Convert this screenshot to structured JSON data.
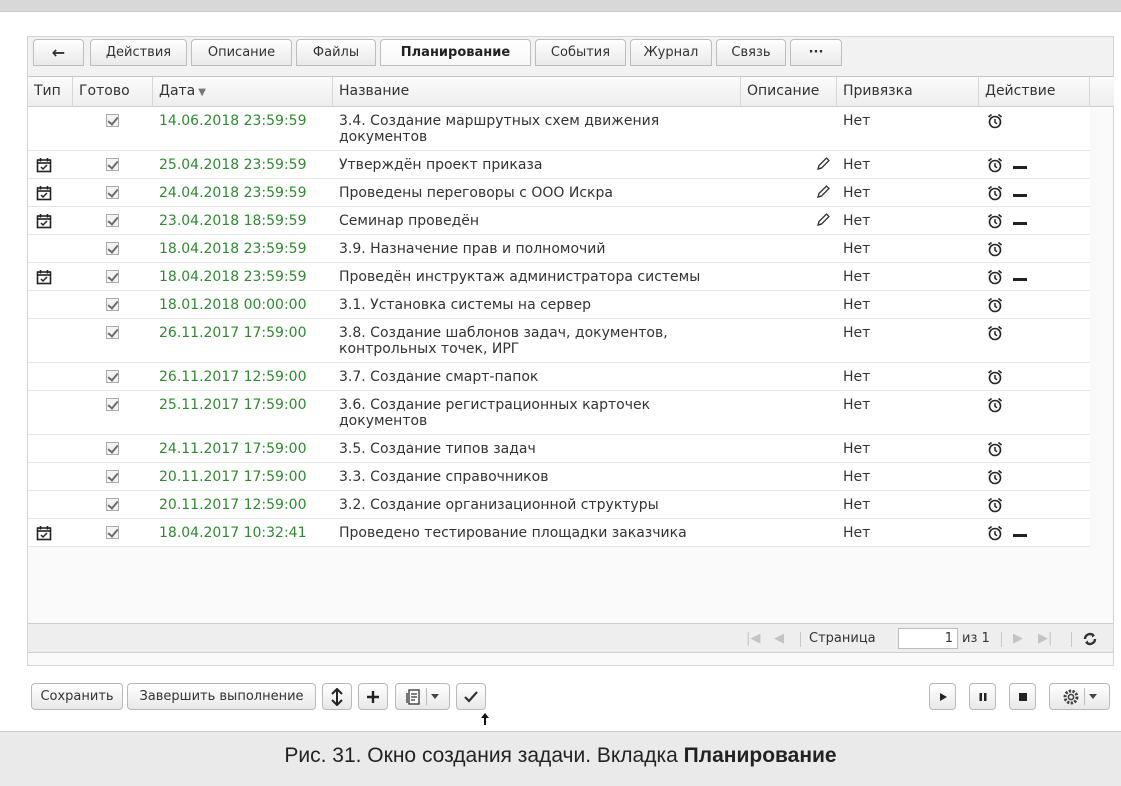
{
  "tabs": [
    {
      "label": "←"
    },
    {
      "label": "Действия"
    },
    {
      "label": "Описание"
    },
    {
      "label": "Файлы"
    },
    {
      "label": "Планирование"
    },
    {
      "label": "События"
    },
    {
      "label": "Журнал"
    },
    {
      "label": "Связь"
    },
    {
      "label": "···"
    }
  ],
  "columns": {
    "type": "Тип",
    "done": "Готово",
    "date": "Дата",
    "name": "Название",
    "description": "Описание",
    "binding": "Привязка",
    "action": "Действие"
  },
  "rows": [
    {
      "has_type_icon": false,
      "done": true,
      "date": "14.06.2018 23:59:59",
      "name": "3.4. Создание маршрутных схем движения документов",
      "has_description": false,
      "binding": "Нет",
      "has_remove": false
    },
    {
      "has_type_icon": true,
      "done": true,
      "date": "25.04.2018 23:59:59",
      "name": "Утверждён проект приказа",
      "has_description": true,
      "binding": "Нет",
      "has_remove": true
    },
    {
      "has_type_icon": true,
      "done": true,
      "date": "24.04.2018 23:59:59",
      "name": "Проведены переговоры с ООО Искра",
      "has_description": true,
      "binding": "Нет",
      "has_remove": true
    },
    {
      "has_type_icon": true,
      "done": true,
      "date": "23.04.2018 18:59:59",
      "name": "Семинар проведён",
      "has_description": true,
      "binding": "Нет",
      "has_remove": true
    },
    {
      "has_type_icon": false,
      "done": true,
      "date": "18.04.2018 23:59:59",
      "name": "3.9. Назначение прав и полномочий",
      "has_description": false,
      "binding": "Нет",
      "has_remove": false
    },
    {
      "has_type_icon": true,
      "done": true,
      "date": "18.04.2018 23:59:59",
      "name": "Проведён инструктаж администратора системы",
      "has_description": false,
      "binding": "Нет",
      "has_remove": true
    },
    {
      "has_type_icon": false,
      "done": true,
      "date": "18.01.2018 00:00:00",
      "name": "3.1. Установка системы на сервер",
      "has_description": false,
      "binding": "Нет",
      "has_remove": false
    },
    {
      "has_type_icon": false,
      "done": true,
      "date": "26.11.2017 17:59:00",
      "name": "3.8. Создание шаблонов задач, документов, контрольных точек, ИРГ",
      "has_description": false,
      "binding": "Нет",
      "has_remove": false
    },
    {
      "has_type_icon": false,
      "done": true,
      "date": "26.11.2017 12:59:00",
      "name": "3.7. Создание смарт-папок",
      "has_description": false,
      "binding": "Нет",
      "has_remove": false
    },
    {
      "has_type_icon": false,
      "done": true,
      "date": "25.11.2017 17:59:00",
      "name": "3.6. Создание регистрационных карточек документов",
      "has_description": false,
      "binding": "Нет",
      "has_remove": false
    },
    {
      "has_type_icon": false,
      "done": true,
      "date": "24.11.2017 17:59:00",
      "name": "3.5. Создание типов задач",
      "has_description": false,
      "binding": "Нет",
      "has_remove": false
    },
    {
      "has_type_icon": false,
      "done": true,
      "date": "20.11.2017 17:59:00",
      "name": "3.3. Создание справочников",
      "has_description": false,
      "binding": "Нет",
      "has_remove": false
    },
    {
      "has_type_icon": false,
      "done": true,
      "date": "20.11.2017 12:59:00",
      "name": "3.2. Создание организационной структуры",
      "has_description": false,
      "binding": "Нет",
      "has_remove": false
    },
    {
      "has_type_icon": true,
      "done": true,
      "date": "18.04.2017 10:32:41",
      "name": "Проведено тестирование площадки заказчика",
      "has_description": false,
      "binding": "Нет",
      "has_remove": true
    }
  ],
  "pager": {
    "page_label": "Страница",
    "page_value": "1",
    "of_label": "из 1"
  },
  "toolbar": {
    "save_label": "Сохранить",
    "complete_label": "Завершить выполнение"
  },
  "caption": {
    "prefix": "Рис. 31. Окно создания задачи. Вкладка ",
    "bold": "Планирование"
  },
  "colors": {
    "date_text": "#2e8b2e"
  }
}
